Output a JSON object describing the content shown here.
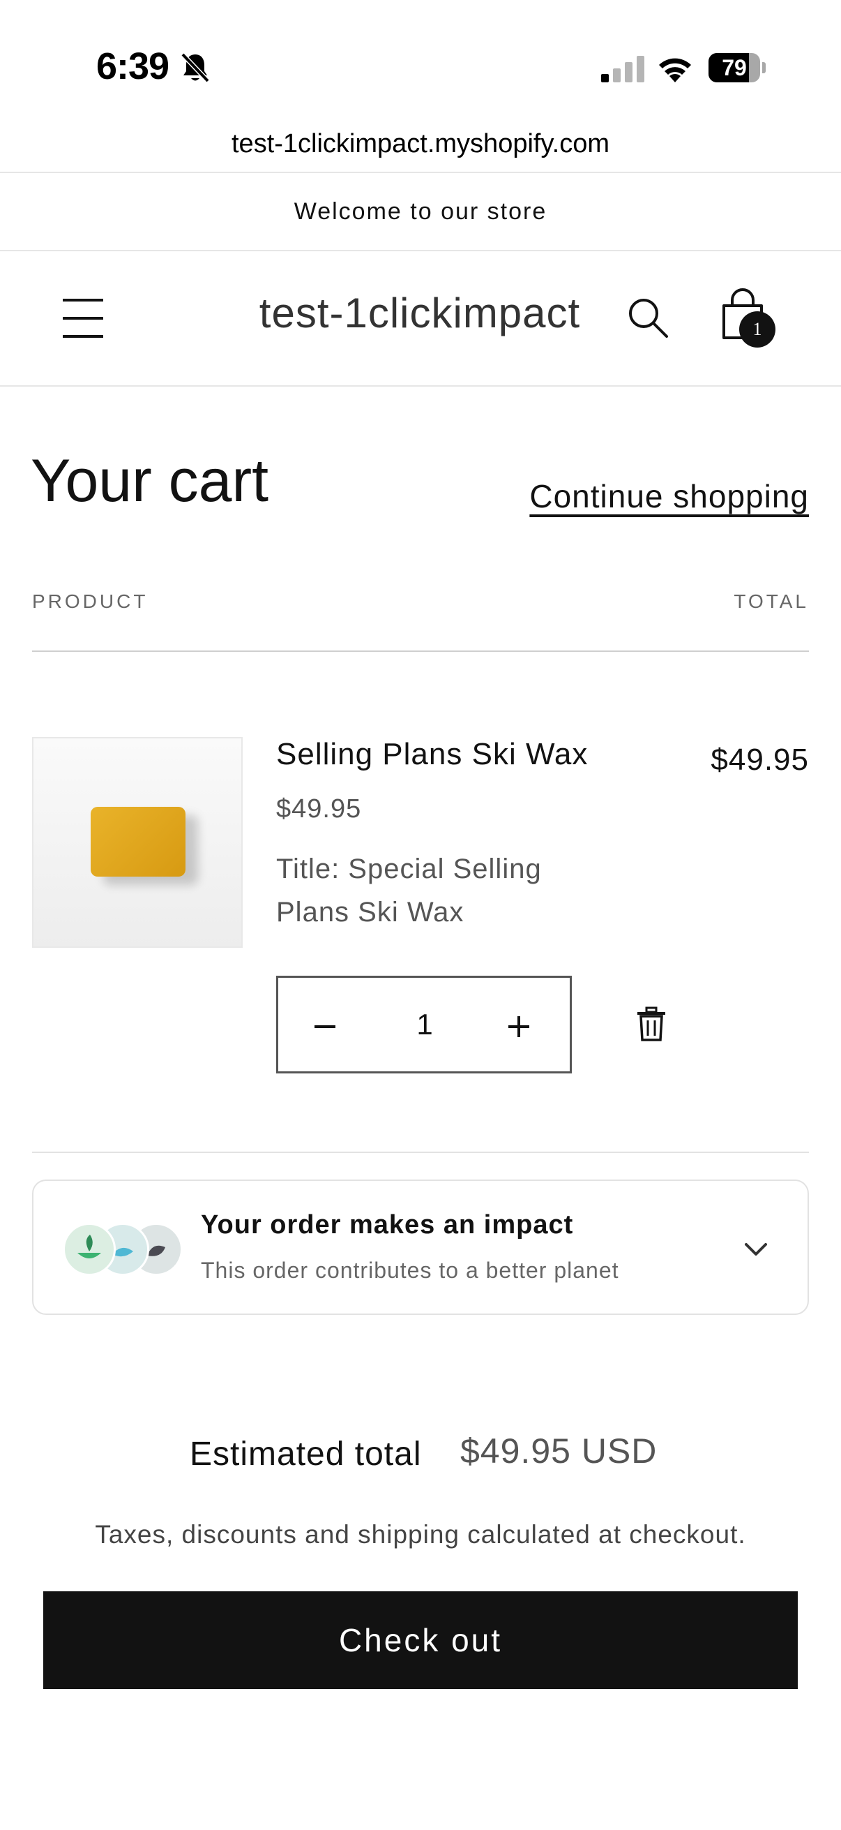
{
  "status_bar": {
    "time": "6:39",
    "battery": "79",
    "battery_level": 0.79
  },
  "browser": {
    "url": "test-1clickimpact.myshopify.com"
  },
  "announcement": "Welcome to our store",
  "header": {
    "store_name": "test-1clickimpact",
    "cart_count": "1"
  },
  "cart": {
    "title": "Your cart",
    "continue_label": "Continue shopping",
    "col_product": "PRODUCT",
    "col_total": "TOTAL",
    "item": {
      "name": "Selling Plans Ski Wax",
      "price": "$49.95",
      "option": "Title: Special Selling Plans Ski Wax",
      "quantity": "1",
      "line_total": "$49.95"
    }
  },
  "impact": {
    "title": "Your order makes an impact",
    "subtitle": "This order contributes to a better planet"
  },
  "totals": {
    "estimated_label": "Estimated total",
    "estimated_value": "$49.95 USD",
    "tax_note": "Taxes, discounts and shipping calculated at checkout.",
    "checkout_label": "Check out"
  },
  "colors": {
    "accent": "#121212",
    "background": "#ffffff",
    "muted_text": "#555555"
  }
}
